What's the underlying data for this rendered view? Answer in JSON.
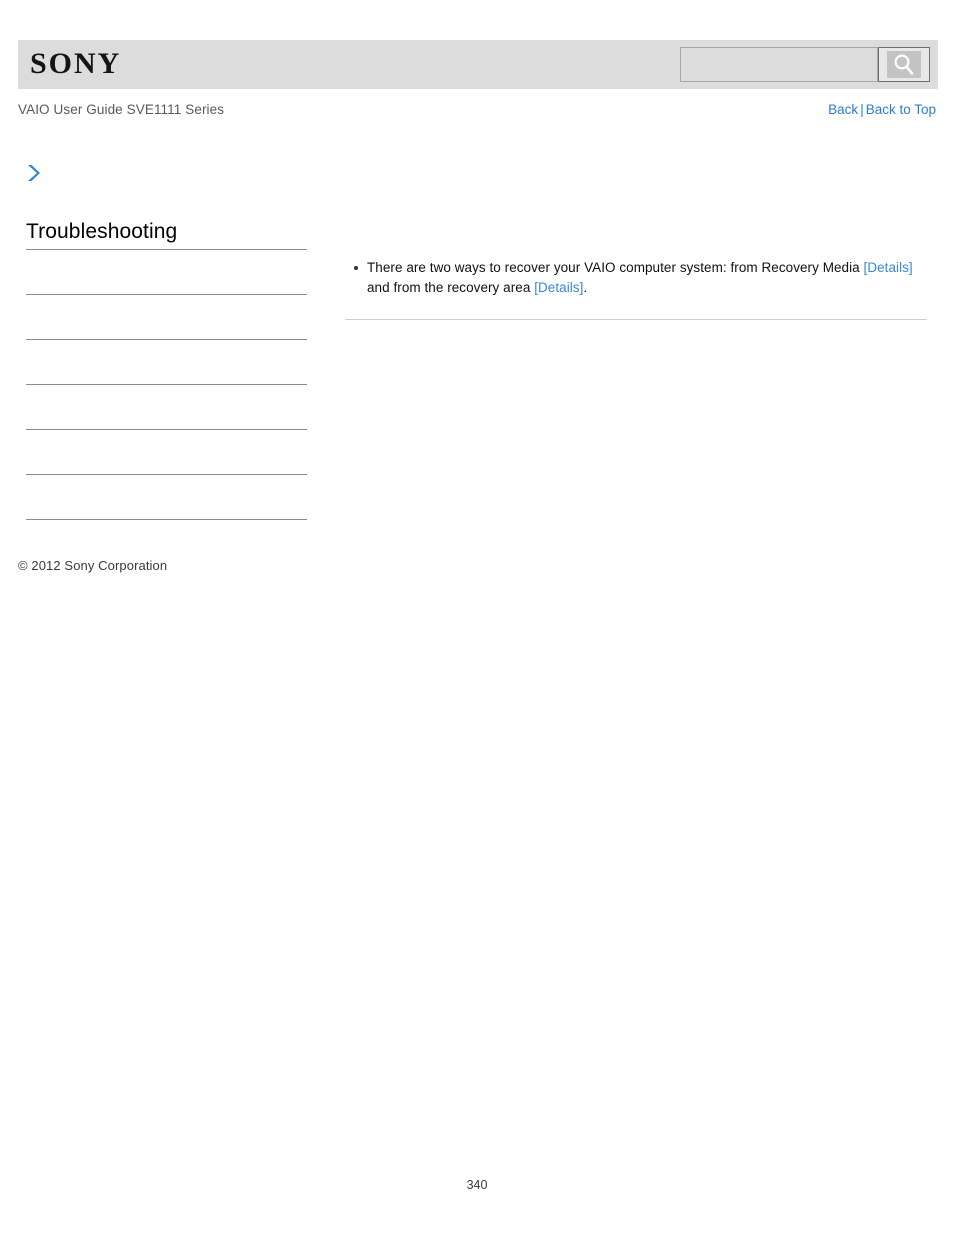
{
  "header": {
    "logo_text": "SONY",
    "logo_icon": "sony-wordmark",
    "search": {
      "value": "",
      "placeholder": "",
      "button_icon": "search-magnifier-icon"
    }
  },
  "subheader": {
    "guide_title": "VAIO User Guide SVE1111 Series",
    "back_label": "Back",
    "separator": "|",
    "back_to_top_label": "Back to Top"
  },
  "breadcrumb": {
    "icon": "chevron-right-icon",
    "text": ""
  },
  "sidebar": {
    "title": "Troubleshooting",
    "items": [
      {
        "label": ""
      },
      {
        "label": ""
      },
      {
        "label": ""
      },
      {
        "label": ""
      },
      {
        "label": ""
      },
      {
        "label": ""
      }
    ],
    "copyright": "© 2012 Sony Corporation"
  },
  "main": {
    "bullets": [
      {
        "text_before": "There are two ways to recover your VAIO computer system: from Recovery Media ",
        "link1": "[Details]",
        "text_middle": " and from the recovery area ",
        "link2": "[Details]",
        "text_after": "."
      }
    ]
  },
  "footer": {
    "page_number": "340"
  },
  "colors": {
    "header_band": "#dcdcdc",
    "link_blue": "#2b7cd3",
    "content_link_blue": "#3a86d8",
    "rule_gray": "#8d8d8d",
    "content_rule_gray": "#cfcfcf",
    "chevron_blue": "#2f86c8"
  }
}
